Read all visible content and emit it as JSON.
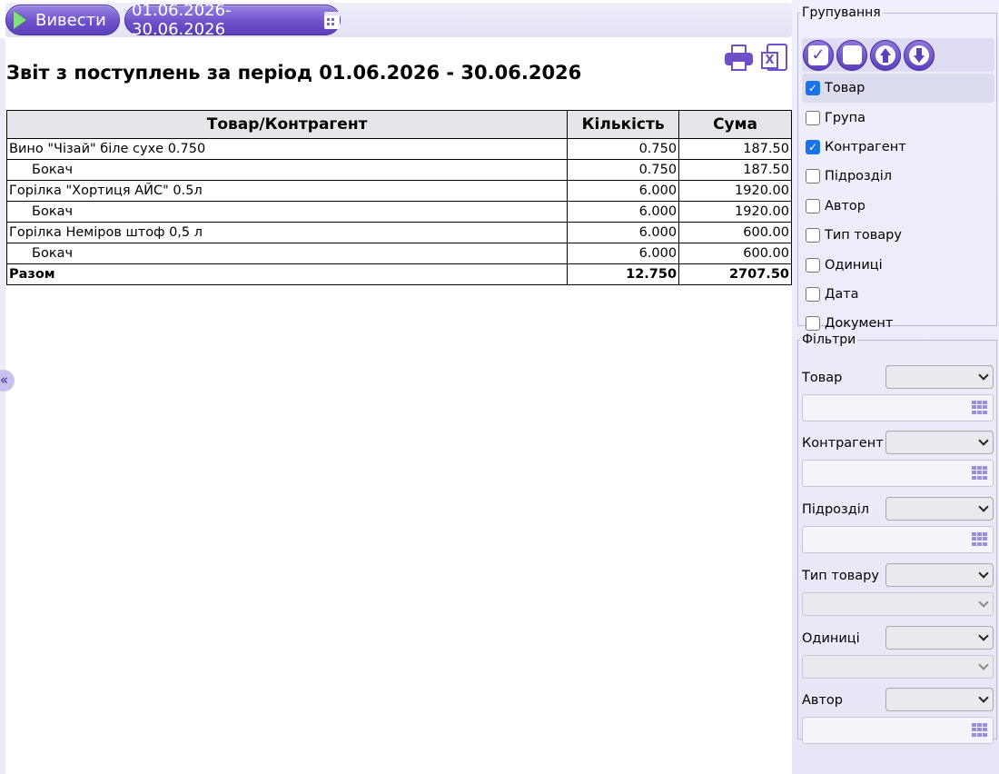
{
  "toolbar": {
    "run_label": "Вивести",
    "period_label": "01.06.2026-30.06.2026"
  },
  "report": {
    "title": "Звіт з поступлень за період 01.06.2026 - 30.06.2026",
    "columns": [
      "Товар/Контрагент",
      "Кількість",
      "Сума"
    ],
    "rows": [
      {
        "name": "Вино \"Чізай\" біле сухе 0.750",
        "qty": "0.750",
        "sum": "187.50",
        "level": 0
      },
      {
        "name": "Бокач",
        "qty": "0.750",
        "sum": "187.50",
        "level": 1
      },
      {
        "name": "Горілка \"Хортиця АЙС\" 0.5л",
        "qty": "6.000",
        "sum": "1920.00",
        "level": 0
      },
      {
        "name": "Бокач",
        "qty": "6.000",
        "sum": "1920.00",
        "level": 1
      },
      {
        "name": "Горілка Неміров штоф 0,5 л",
        "qty": "6.000",
        "sum": "600.00",
        "level": 0
      },
      {
        "name": "Бокач",
        "qty": "6.000",
        "sum": "600.00",
        "level": 1
      }
    ],
    "total": {
      "name": "Разом",
      "qty": "12.750",
      "sum": "2707.50"
    }
  },
  "grouping": {
    "legend": "Групування",
    "items": [
      {
        "label": "Товар",
        "checked": true,
        "active": true
      },
      {
        "label": "Група",
        "checked": false
      },
      {
        "label": "Контрагент",
        "checked": true
      },
      {
        "label": "Підрозділ",
        "checked": false
      },
      {
        "label": "Автор",
        "checked": false
      },
      {
        "label": "Тип товару",
        "checked": false
      },
      {
        "label": "Одиниці",
        "checked": false
      },
      {
        "label": "Дата",
        "checked": false
      },
      {
        "label": "Документ",
        "checked": false
      }
    ]
  },
  "filters": {
    "legend": "Фільтри",
    "items": [
      {
        "label": "Товар",
        "value_kind": "lookup"
      },
      {
        "label": "Контрагент",
        "value_kind": "lookup"
      },
      {
        "label": "Підрозділ",
        "value_kind": "lookup"
      },
      {
        "label": "Тип товару",
        "value_kind": "select"
      },
      {
        "label": "Одиниці",
        "value_kind": "select"
      },
      {
        "label": "Автор",
        "value_kind": "lookup"
      }
    ]
  },
  "collapse_glyph": "«",
  "colors": {
    "accent": "#6f52cc",
    "panel_bg": "#eeeefb",
    "checkbox_on": "#1a73e8"
  }
}
